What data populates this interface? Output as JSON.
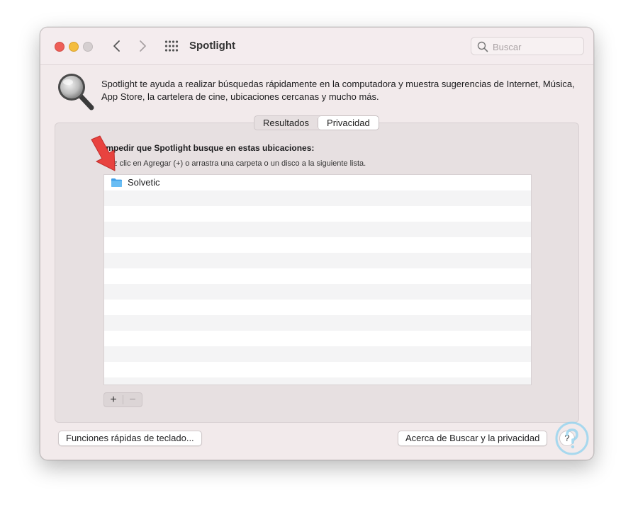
{
  "window": {
    "title": "Spotlight"
  },
  "search": {
    "placeholder": "Buscar"
  },
  "header": {
    "description": "Spotlight te ayuda a realizar búsquedas rápidamente en la computadora y muestra sugerencias de Internet, Música, App Store, la cartelera de cine, ubicaciones cercanas y mucho más."
  },
  "tabs": [
    {
      "label": "Resultados",
      "selected": false
    },
    {
      "label": "Privacidad",
      "selected": true
    }
  ],
  "privacy": {
    "title": "Impedir que Spotlight busque en estas ubicaciones:",
    "hint": "Haz clic en Agregar (+) o arrastra una carpeta o un disco a la siguiente lista.",
    "items": [
      {
        "name": "Solvetic",
        "icon": "folder-icon"
      }
    ],
    "add_label": "+",
    "remove_label": "−"
  },
  "footer": {
    "shortcuts_label": "Funciones rápidas de teclado...",
    "about_label": "Acerca de Buscar y la privacidad",
    "help_label": "?"
  },
  "colors": {
    "window_bg": "#f2eaeb",
    "close": "#ee5e57",
    "minimize": "#f4bd3e",
    "folder": "#5ab4f0",
    "arrow": "#e8433f"
  }
}
